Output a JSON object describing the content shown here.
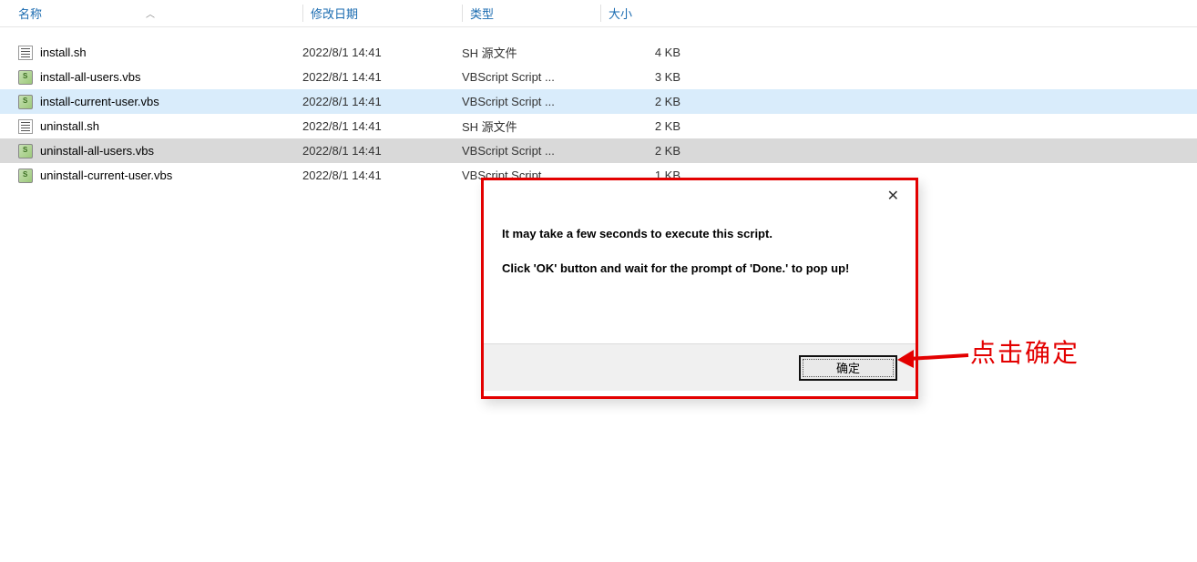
{
  "columns": {
    "name": "名称",
    "date": "修改日期",
    "type": "类型",
    "size": "大小"
  },
  "files": [
    {
      "name": "install.sh",
      "date": "2022/8/1 14:41",
      "type": "SH 源文件",
      "size": "4 KB",
      "icon": "sh",
      "state": ""
    },
    {
      "name": "install-all-users.vbs",
      "date": "2022/8/1 14:41",
      "type": "VBScript Script ...",
      "size": "3 KB",
      "icon": "vbs",
      "state": ""
    },
    {
      "name": "install-current-user.vbs",
      "date": "2022/8/1 14:41",
      "type": "VBScript Script ...",
      "size": "2 KB",
      "icon": "vbs",
      "state": "hover"
    },
    {
      "name": "uninstall.sh",
      "date": "2022/8/1 14:41",
      "type": "SH 源文件",
      "size": "2 KB",
      "icon": "sh",
      "state": ""
    },
    {
      "name": "uninstall-all-users.vbs",
      "date": "2022/8/1 14:41",
      "type": "VBScript Script ...",
      "size": "2 KB",
      "icon": "vbs",
      "state": "selected"
    },
    {
      "name": "uninstall-current-user.vbs",
      "date": "2022/8/1 14:41",
      "type": "VBScript Script ...",
      "size": "1 KB",
      "icon": "vbs",
      "state": ""
    }
  ],
  "dialog": {
    "line1": "It may take a few seconds to execute this script.",
    "line2": "Click 'OK' button and wait for the prompt of 'Done.' to pop up!",
    "okLabel": "确定"
  },
  "callout": "点击确定"
}
